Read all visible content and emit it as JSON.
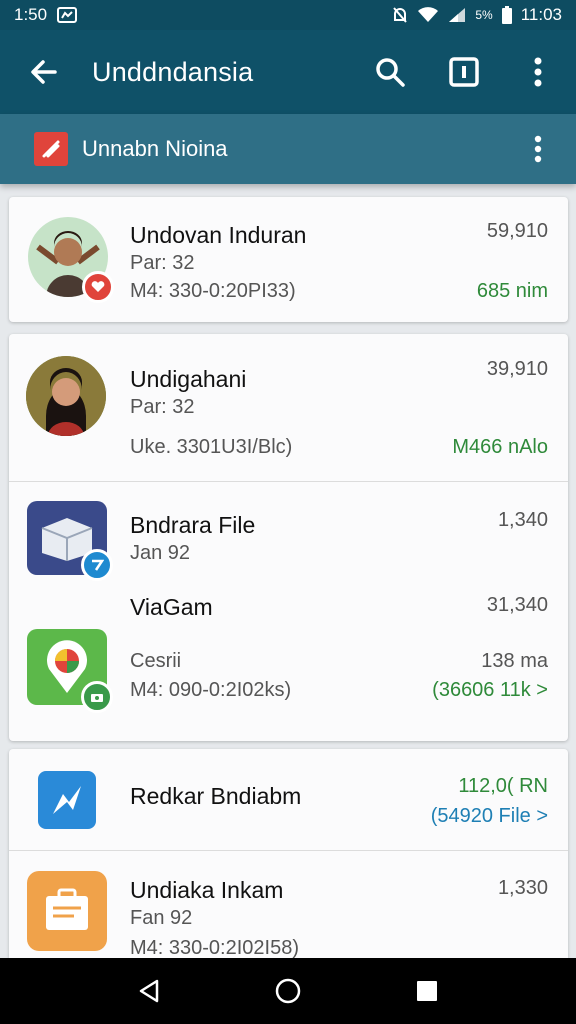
{
  "status_bar": {
    "time_left": "1:50",
    "time_right": "11:03",
    "battery_text": "5%"
  },
  "header": {
    "title": "Unddndansia"
  },
  "subheader": {
    "title": "Unnabn Nioina"
  },
  "items": [
    {
      "name": "Undovan Induran",
      "line1": "Par: 32",
      "line2": "M4: 330-0:20PI33)",
      "value": "59,910",
      "status": "685 nim"
    },
    {
      "name": "Undigahani",
      "line1": "Par: 32",
      "line2": "Uke. 3301U3I/Blc)",
      "value": "39,910",
      "status": "M466 nAlo"
    },
    {
      "name": "Bndrara File",
      "line1": "Jan 92",
      "value": "1,340"
    },
    {
      "name": "ViaGam",
      "value": "31,340",
      "line1": "Cesrii",
      "value2": "138 ma",
      "line2": "M4: 090-0:2I02ks)",
      "status": "(36606 11k >"
    },
    {
      "name": "Redkar Bndiabm",
      "value": "112,0( RN",
      "status": "(54920 File >"
    },
    {
      "name": "Undiaka Inkam",
      "line1": "Fan 92",
      "line2": "M4: 330-0:2I02I58)",
      "value": "1,330"
    }
  ],
  "colors": {
    "app_bar": "#0f5168",
    "sub_bar": "#2f6f86",
    "accent_green": "#2f8a3a",
    "accent_blue": "#1e7fb4"
  }
}
